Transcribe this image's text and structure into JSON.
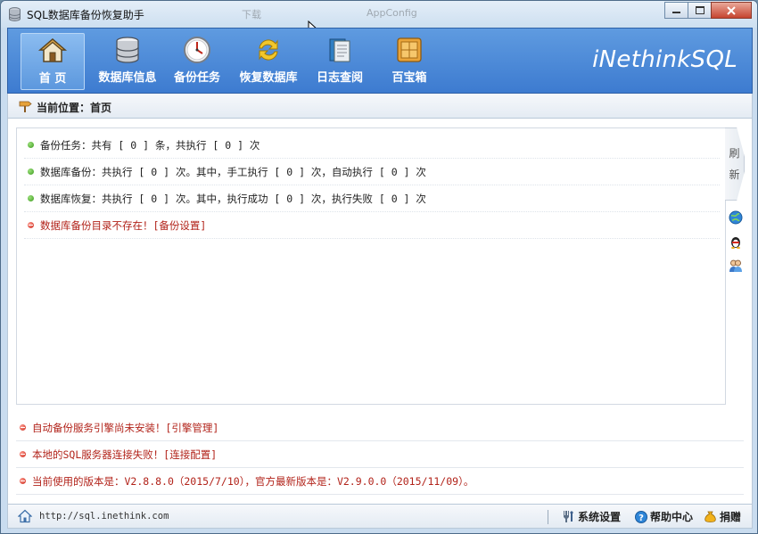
{
  "window": {
    "title": "SQL数据库备份恢复助手",
    "background_tabs": [
      "下载",
      "AppConfig"
    ]
  },
  "toolbar": {
    "items": [
      {
        "label": "首 页",
        "icon": "home-icon",
        "active": true
      },
      {
        "label": "数据库信息",
        "icon": "database-icon",
        "active": false
      },
      {
        "label": "备份任务",
        "icon": "clock-icon",
        "active": false
      },
      {
        "label": "恢复数据库",
        "icon": "refresh-icon",
        "active": false
      },
      {
        "label": "日志查阅",
        "icon": "log-book-icon",
        "active": false
      },
      {
        "label": "百宝箱",
        "icon": "toolbox-icon",
        "active": false
      }
    ],
    "brand": "iNethinkSQL"
  },
  "breadcrumb": {
    "text": "当前位置：首页"
  },
  "summary": {
    "rows": [
      {
        "status": "ok",
        "text": "备份任务：共有 [ 0 ] 条，共执行 [ 0 ] 次"
      },
      {
        "status": "ok",
        "text": "数据库备份：共执行 [ 0 ] 次。其中，手工执行 [ 0 ] 次，自动执行 [ 0 ] 次"
      },
      {
        "status": "ok",
        "text": "数据库恢复：共执行 [ 0 ] 次。其中，执行成功 [ 0 ] 次，执行失败 [ 0 ] 次"
      },
      {
        "status": "error",
        "text": "数据库备份目录不存在！",
        "link": "[备份设置]"
      }
    ],
    "refresh_label": "刷 新"
  },
  "notices": [
    {
      "text": "自动备份服务引擎尚未安装！",
      "link": "[引擎管理]"
    },
    {
      "text": "本地的SQL服务器连接失败！",
      "link": "[连接配置]"
    },
    {
      "text": "当前使用的版本是：V2.8.8.0（2015/7/10），官方最新版本是：V2.9.0.0（2015/11/09）。",
      "link": ""
    }
  ],
  "statusbar": {
    "url": "http://sql.inethink.com",
    "settings": "系统设置",
    "help": "帮助中心",
    "donate": "捐赠"
  },
  "colors": {
    "toolbar_blue": "#4a88d8",
    "error_red": "#b2231a",
    "ok_green": "#3c9a1d"
  }
}
